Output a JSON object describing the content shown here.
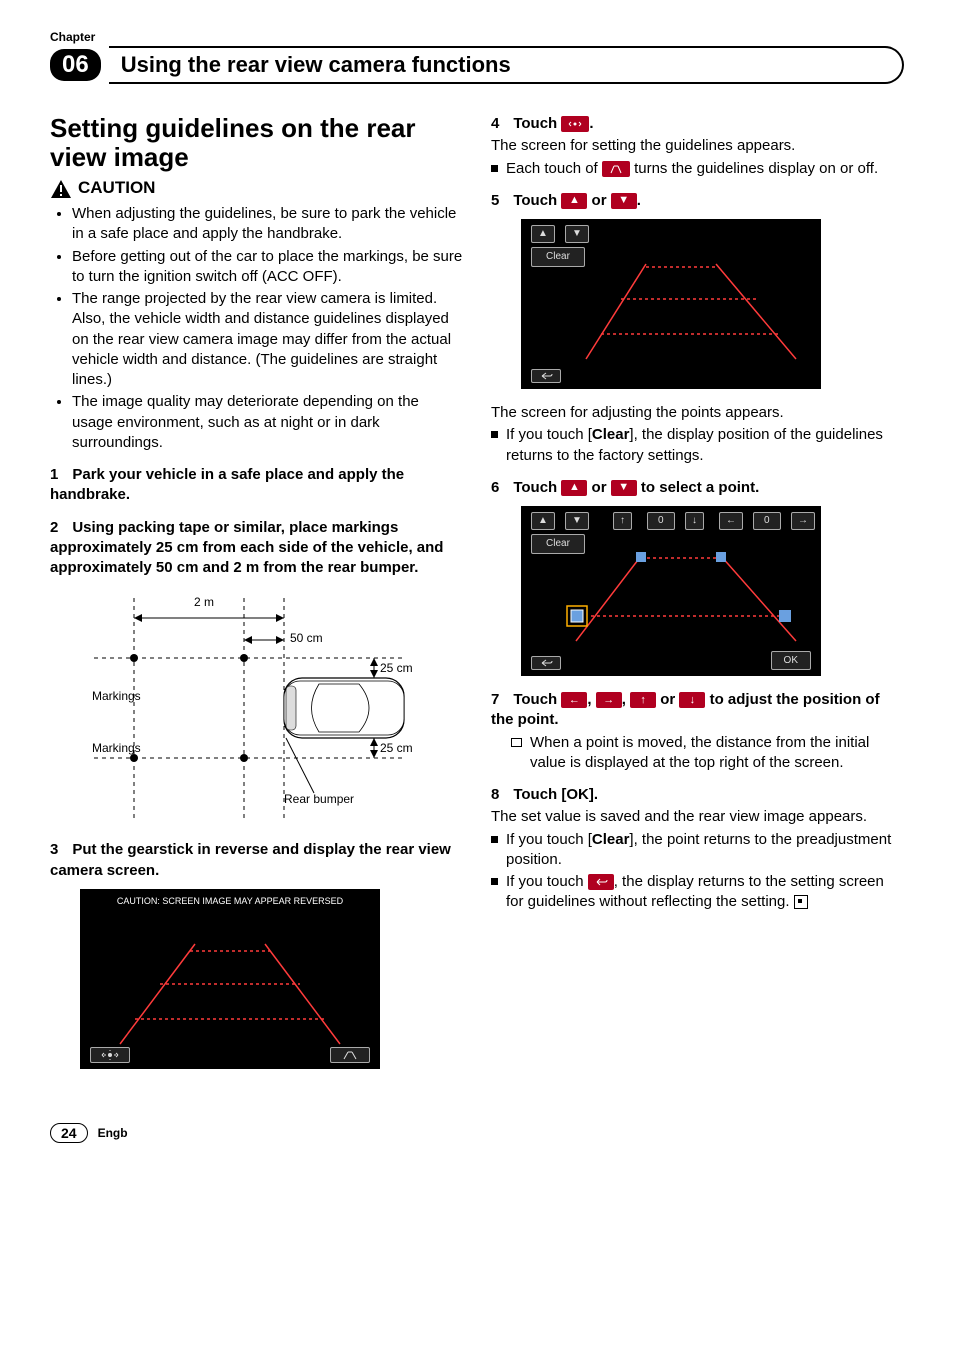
{
  "header": {
    "chapter_label": "Chapter",
    "chapter_number": "06",
    "title": "Using the rear view camera functions"
  },
  "left": {
    "section_title": "Setting guidelines on the rear view image",
    "caution_label": "CAUTION",
    "caution_items": [
      "When adjusting the guidelines, be sure to park the vehicle in a safe place and apply the handbrake.",
      "Before getting out of the car to place the markings, be sure to turn the ignition switch off (ACC OFF).",
      "The range projected by the rear view camera is limited. Also, the vehicle width and distance guidelines displayed on the rear view camera image may differ from the actual vehicle width and distance. (The guidelines are straight lines.)",
      "The image quality may deteriorate depending on the usage environment, such as at night or in dark surroundings."
    ],
    "step1_num": "1",
    "step1_text": "Park your vehicle in a safe place and apply the handbrake.",
    "step2_num": "2",
    "step2_text": "Using packing tape or similar, place markings approximately 25 cm from each side of the vehicle, and approximately 50 cm and 2 m from the rear bumper.",
    "diagram": {
      "d2m": "2 m",
      "d50": "50 cm",
      "d25a": "25 cm",
      "d25b": "25 cm",
      "markings1": "Markings",
      "markings2": "Markings",
      "rear": "Rear bumper"
    },
    "step3_num": "3",
    "step3_text": "Put the gearstick in reverse and display the rear view camera screen.",
    "screen3_caption": "CAUTION: SCREEN IMAGE MAY APPEAR REVERSED"
  },
  "right": {
    "step4_num": "4",
    "step4_pre": "Touch ",
    "step4_post": ".",
    "step4_body": "The screen for setting the guidelines appears.",
    "step4_bullet_pre": "Each touch of ",
    "step4_bullet_post": " turns the guidelines display on or off.",
    "step5_num": "5",
    "step5_pre": "Touch ",
    "step5_or": " or ",
    "step5_post": ".",
    "screen5_clear": "Clear",
    "step5_body": "The screen for adjusting the points appears.",
    "step5_bullet_pre": "If you touch [",
    "step5_bullet_clear": "Clear",
    "step5_bullet_post": "], the display position of the guidelines returns to the factory settings.",
    "step6_num": "6",
    "step6_pre": "Touch ",
    "step6_or": " or ",
    "step6_post": " to select a point.",
    "screen6_clear": "Clear",
    "screen6_ok": "OK",
    "screen6_zero": "0",
    "step7_num": "7",
    "step7_pre": "Touch ",
    "step7_c1": ", ",
    "step7_c2": ", ",
    "step7_or": " or ",
    "step7_post": " to adjust the position of the point.",
    "step7_hollow": "When a point is moved, the distance from the initial value is displayed at the top right of the screen.",
    "step8_num": "8",
    "step8_text": "Touch [OK].",
    "step8_body": "The set value is saved and the rear view image appears.",
    "step8_b1_pre": "If you touch [",
    "step8_b1_clear": "Clear",
    "step8_b1_post": "], the point returns to the preadjustment position.",
    "step8_b2_pre": "If you touch ",
    "step8_b2_post": ", the display returns to the setting screen for guidelines without reflecting the setting."
  },
  "footer": {
    "page": "24",
    "lang": "Engb"
  }
}
